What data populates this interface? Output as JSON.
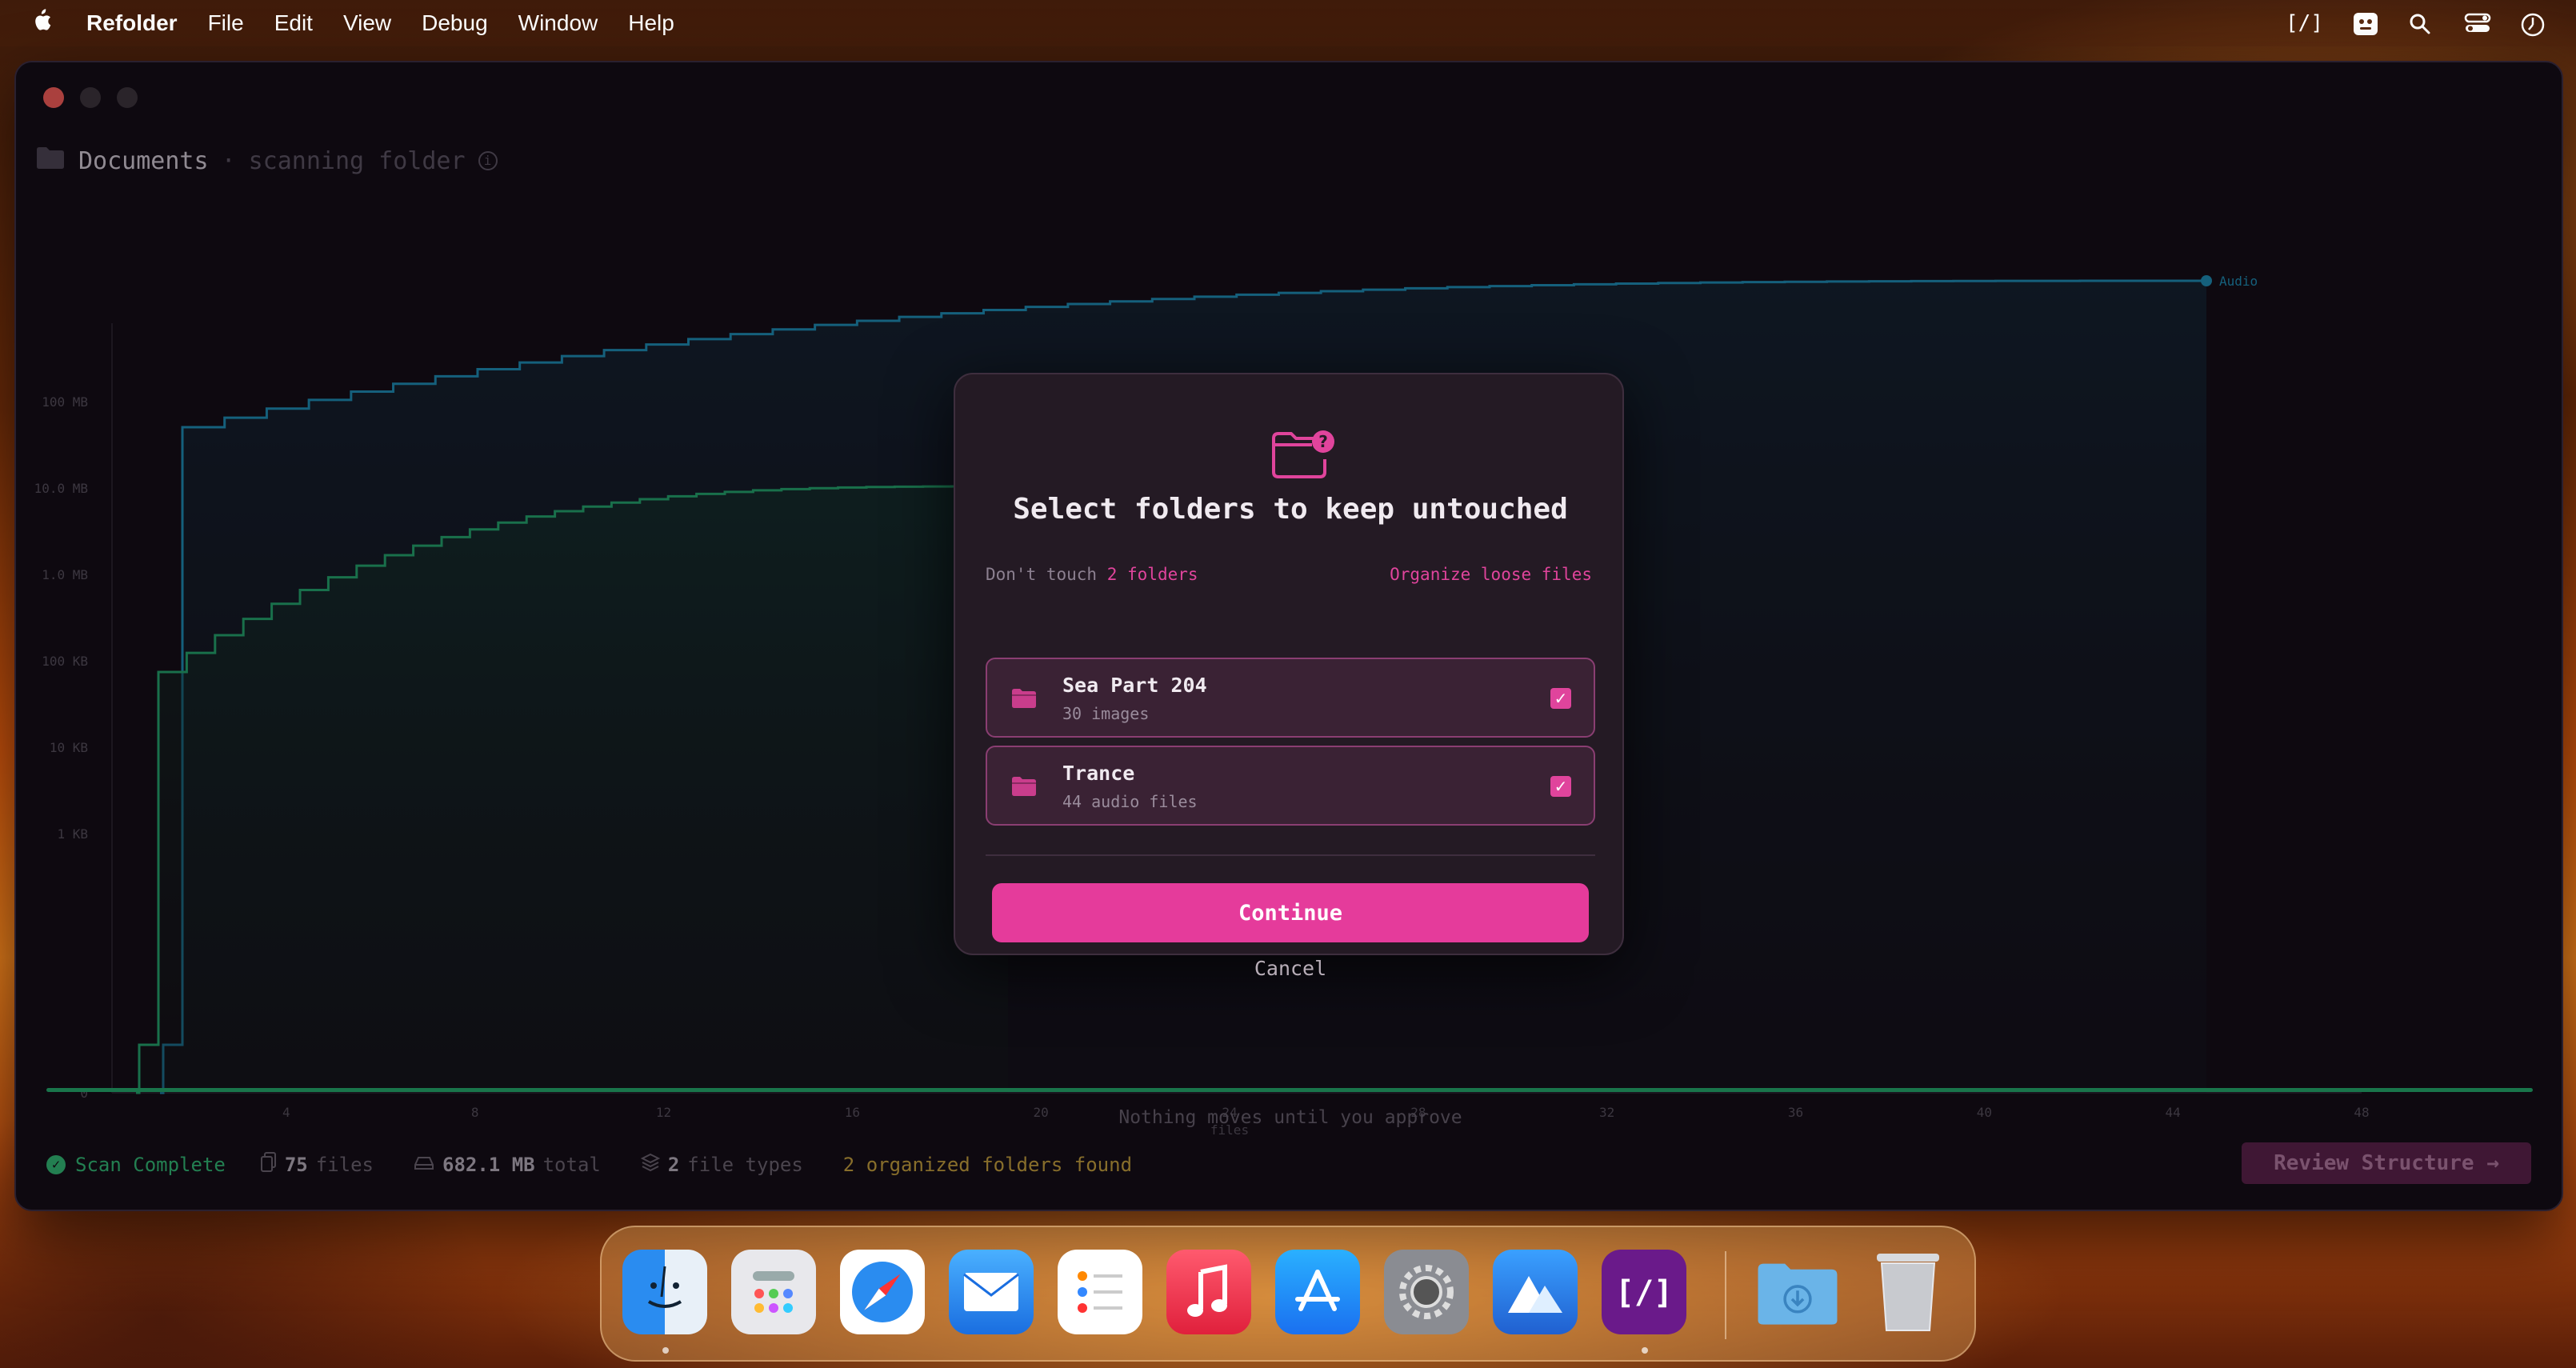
{
  "menubar": {
    "app_name": "Refolder",
    "items": [
      "File",
      "Edit",
      "View",
      "Debug",
      "Window",
      "Help"
    ],
    "status_glyph": "[/]"
  },
  "window": {
    "folder_name": "Documents",
    "separator": "·",
    "subtitle": "scanning folder"
  },
  "chart_data": {
    "type": "line",
    "step": true,
    "y_scale": "log",
    "y_ticks": [
      "100 MB",
      "10.0 MB",
      "1.0 MB",
      "100 KB",
      "10 KB",
      "1 KB",
      "0"
    ],
    "x_ticks": [
      "4",
      "8",
      "12",
      "16",
      "20",
      "24",
      "28",
      "32",
      "36",
      "40",
      "44",
      "48"
    ],
    "xlabel": "files",
    "xlim": [
      0,
      48
    ],
    "series": [
      {
        "name": "Audio",
        "color": "#1a8fb5"
      },
      {
        "name": "",
        "color": "#1fa86a"
      }
    ]
  },
  "footer": {
    "message": "Nothing moves until you approve",
    "scan_status": "Scan Complete",
    "files_count": "75",
    "files_label": "files",
    "total_size": "682.1 MB",
    "total_label": "total",
    "types_count": "2",
    "types_label": "file types",
    "organized_found": "2 organized folders found",
    "review_label": "Review Structure →"
  },
  "modal": {
    "title": "Select folders to keep untouched",
    "subtitle_prefix": "Don't touch",
    "subtitle_count": "2 folders",
    "organize_link": "Organize loose files",
    "folders": [
      {
        "name": "Sea Part 204",
        "meta": "30 images",
        "checked": true
      },
      {
        "name": "Trance",
        "meta": "44 audio files",
        "checked": true
      }
    ],
    "continue_label": "Continue",
    "cancel_label": "Cancel"
  },
  "dock": {
    "apps": [
      "Finder",
      "Launchpad",
      "Safari",
      "Mail",
      "Reminders",
      "Music",
      "App Store",
      "System Settings",
      "Altitude",
      "Refolder",
      "Downloads",
      "Trash"
    ]
  }
}
